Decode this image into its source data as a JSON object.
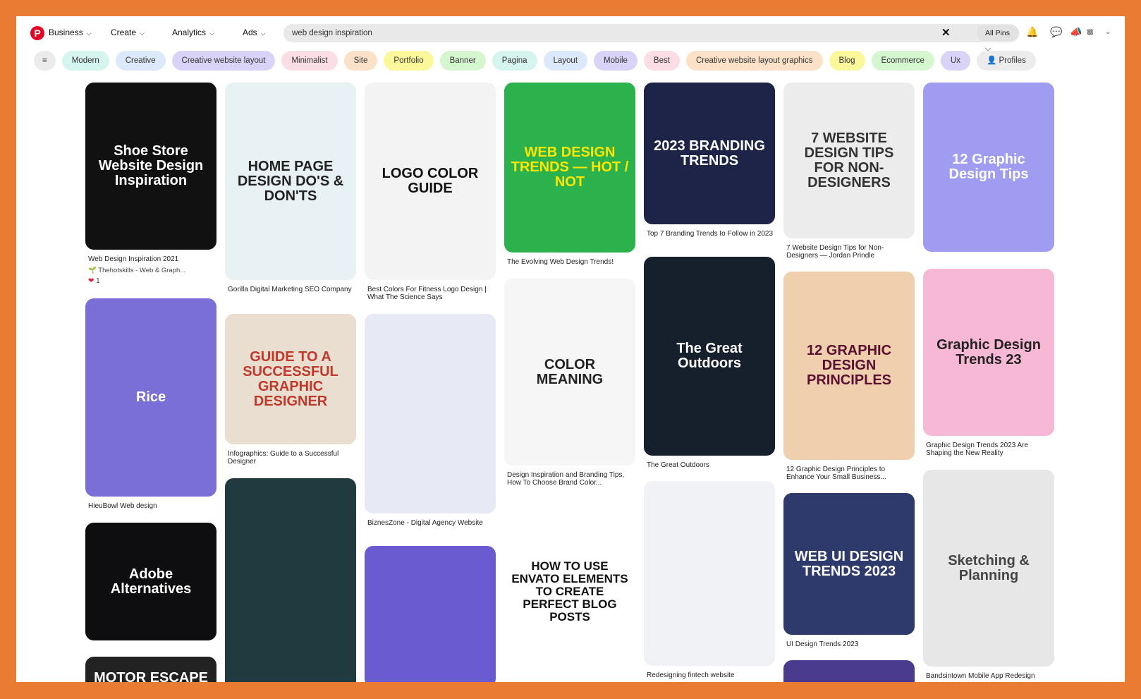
{
  "header": {
    "logo": "P",
    "nav": [
      {
        "label": "Business"
      },
      {
        "label": "Create"
      },
      {
        "label": "Analytics"
      },
      {
        "label": "Ads"
      }
    ],
    "search_value": "web design inspiration",
    "clear_icon": "close-icon",
    "scope": "All Pins",
    "icons": [
      "bell-icon",
      "chat-icon",
      "megaphone-icon",
      "account-icon",
      "chevron-down-icon"
    ]
  },
  "filters": {
    "icon": "sliders-icon",
    "chips": [
      {
        "label": "Modern",
        "color": "#d6f5ee"
      },
      {
        "label": "Creative",
        "color": "#dbe9fb"
      },
      {
        "label": "Creative website layout",
        "color": "#d9d4f7"
      },
      {
        "label": "Minimalist",
        "color": "#fbdde6"
      },
      {
        "label": "Site",
        "color": "#fbe1c8"
      },
      {
        "label": "Portfolio",
        "color": "#fbf79b"
      },
      {
        "label": "Banner",
        "color": "#d4f7cf"
      },
      {
        "label": "Pagina",
        "color": "#d6f5ee"
      },
      {
        "label": "Layout",
        "color": "#dbe9fb"
      },
      {
        "label": "Mobile",
        "color": "#d9d4f7"
      },
      {
        "label": "Best",
        "color": "#fbdde6"
      },
      {
        "label": "Creative website layout graphics",
        "color": "#fbe1c8"
      },
      {
        "label": "Blog",
        "color": "#fbf79b"
      },
      {
        "label": "Ecommerce",
        "color": "#d4f7cf"
      },
      {
        "label": "Ux",
        "color": "#d9d4f7"
      },
      {
        "label": "Profiles",
        "color": "#ececec"
      }
    ]
  },
  "pins": [
    [
      {
        "image_text": "Shoe Store Website Design Inspiration",
        "bg": "#111111",
        "fg": "#ffffff",
        "caption": "Web Design Inspiration 2021",
        "author": "Thehotskills - Web & Graph...",
        "likes": "1"
      },
      {
        "image_text": "Rice",
        "bg": "#7a6fd6",
        "fg": "#ffffff",
        "caption": "HieuBowl Web design"
      },
      {
        "image_text": "Adobe Alternatives",
        "bg": "#0e0e10",
        "fg": "#ffffff",
        "caption": ""
      },
      {
        "image_text": "MOTOR ESCAPE",
        "bg": "#222222",
        "fg": "#ffffff",
        "caption": ""
      }
    ],
    [
      {
        "image_text": "HOME PAGE DESIGN DO'S & DON'TS",
        "bg": "#e8f1f3",
        "fg": "#222222",
        "caption": "Gorilla Digital Marketing SEO Company"
      },
      {
        "image_text": "GUIDE TO A SUCCESSFUL GRAPHIC DESIGNER",
        "bg": "#e9ded0",
        "fg": "#c0392b",
        "caption": "Infographics: Guide to a Successful Designer"
      },
      {
        "image_text": "",
        "bg": "#1f3b3f",
        "fg": "#ffffff",
        "caption": ""
      }
    ],
    [
      {
        "image_text": "LOGO COLOR GUIDE",
        "bg": "#f3f3f3",
        "fg": "#111111",
        "caption": "Best Colors For Fitness Logo Design | What The Science Says"
      },
      {
        "image_text": "",
        "bg": "#e7e9f4",
        "fg": "#333333",
        "caption": "BiznesZone - Digital Agency Website"
      },
      {
        "image_text": "",
        "bg": "#6a5bd1",
        "fg": "#ffffff",
        "caption": ""
      }
    ],
    [
      {
        "image_text": "WEB DESIGN TRENDS — HOT / NOT",
        "bg": "#2bb24c",
        "fg": "#ffe600",
        "caption": "The Evolving Web Design Trends!"
      },
      {
        "image_text": "COLOR MEANING",
        "bg": "#f6f6f6",
        "fg": "#222222",
        "caption": "Design Inspiration and Branding Tips, How To Choose Brand Color..."
      },
      {
        "image_text": "HOW TO USE ENVATO ELEMENTS TO CREATE PERFECT BLOG POSTS",
        "bg": "#ffffff",
        "fg": "#111111",
        "caption": ""
      }
    ],
    [
      {
        "image_text": "2023 BRANDING TRENDS",
        "bg": "#1d2448",
        "fg": "#ffffff",
        "caption": "Top 7 Branding Trends to Follow in 2023"
      },
      {
        "image_text": "The Great Outdoors",
        "bg": "#15202c",
        "fg": "#ffffff",
        "caption": "The Great Outdoors"
      },
      {
        "image_text": "",
        "bg": "#f1f2f6",
        "fg": "#333333",
        "caption": "Redesigning fintech website"
      }
    ],
    [
      {
        "image_text": "7 WEBSITE DESIGN TIPS FOR NON-DESIGNERS",
        "bg": "#ececec",
        "fg": "#333333",
        "caption": "7 Website Design Tips for Non-Designers — Jordan Prindle"
      },
      {
        "image_text": "12 GRAPHIC DESIGN PRINCIPLES",
        "bg": "#f0cfae",
        "fg": "#5a1030",
        "caption": "12 Graphic Design Principles to Enhance Your Small Business..."
      },
      {
        "image_text": "WEB UI DESIGN TRENDS 2023",
        "bg": "#2e3a6b",
        "fg": "#ffffff",
        "caption": "UI Design Trends 2023"
      },
      {
        "image_text": "",
        "bg": "#4a3b8f",
        "fg": "#ffffff",
        "caption": ""
      }
    ],
    [
      {
        "image_text": "12 Graphic Design Tips",
        "bg": "#9f9cf2",
        "fg": "#ffffff",
        "caption": ""
      },
      {
        "image_text": "Graphic Design Trends 23",
        "bg": "#f6b8d4",
        "fg": "#222222",
        "caption": "Graphic Design Trends 2023 Are Shaping the New Reality"
      },
      {
        "image_text": "Sketching & Planning",
        "bg": "#e7e7e7",
        "fg": "#444444",
        "caption": "Bandsintown Mobile App Redesign"
      }
    ]
  ]
}
